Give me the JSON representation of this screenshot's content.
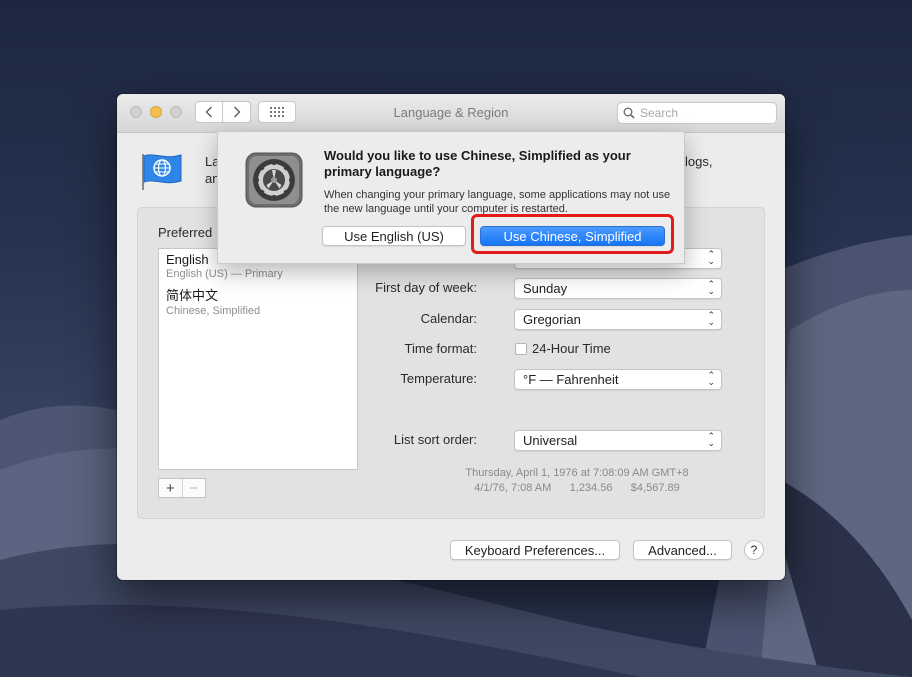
{
  "window": {
    "title": "Language & Region",
    "search_placeholder": "Search"
  },
  "header": {
    "text_line1_visible": "La",
    "text_line1_end": "logs,",
    "text_line2_visible": "an"
  },
  "preferred": {
    "label": "Preferred",
    "languages": [
      {
        "name": "English",
        "sub": "English (US) — Primary"
      },
      {
        "name": "简体中文",
        "sub": "Chinese, Simplified"
      }
    ]
  },
  "settings": {
    "first_day_label": "First day of week:",
    "first_day_value": "Sunday",
    "calendar_label": "Calendar:",
    "calendar_value": "Gregorian",
    "time_format_label": "Time format:",
    "time_format_checkbox": "24-Hour Time",
    "time_format_checked": false,
    "temperature_label": "Temperature:",
    "temperature_value": "°F — Fahrenheit",
    "sort_label": "List sort order:",
    "sort_value": "Universal"
  },
  "sample": {
    "line1": "Thursday, April 1, 1976 at 7:08:09 AM GMT+8",
    "line2": "4/1/76, 7:08 AM      1,234.56      $4,567.89"
  },
  "buttons": {
    "keyboard_prefs": "Keyboard Preferences...",
    "advanced": "Advanced...",
    "help": "?"
  },
  "dialog": {
    "title": "Would you like to use Chinese, Simplified as your primary language?",
    "message": "When changing your primary language, some applications may not use the new language until your computer is restarted.",
    "secondary_button": "Use English (US)",
    "primary_button": "Use Chinese, Simplified"
  },
  "colors": {
    "accent": "#1574f5",
    "highlight": "#e41b1b"
  }
}
